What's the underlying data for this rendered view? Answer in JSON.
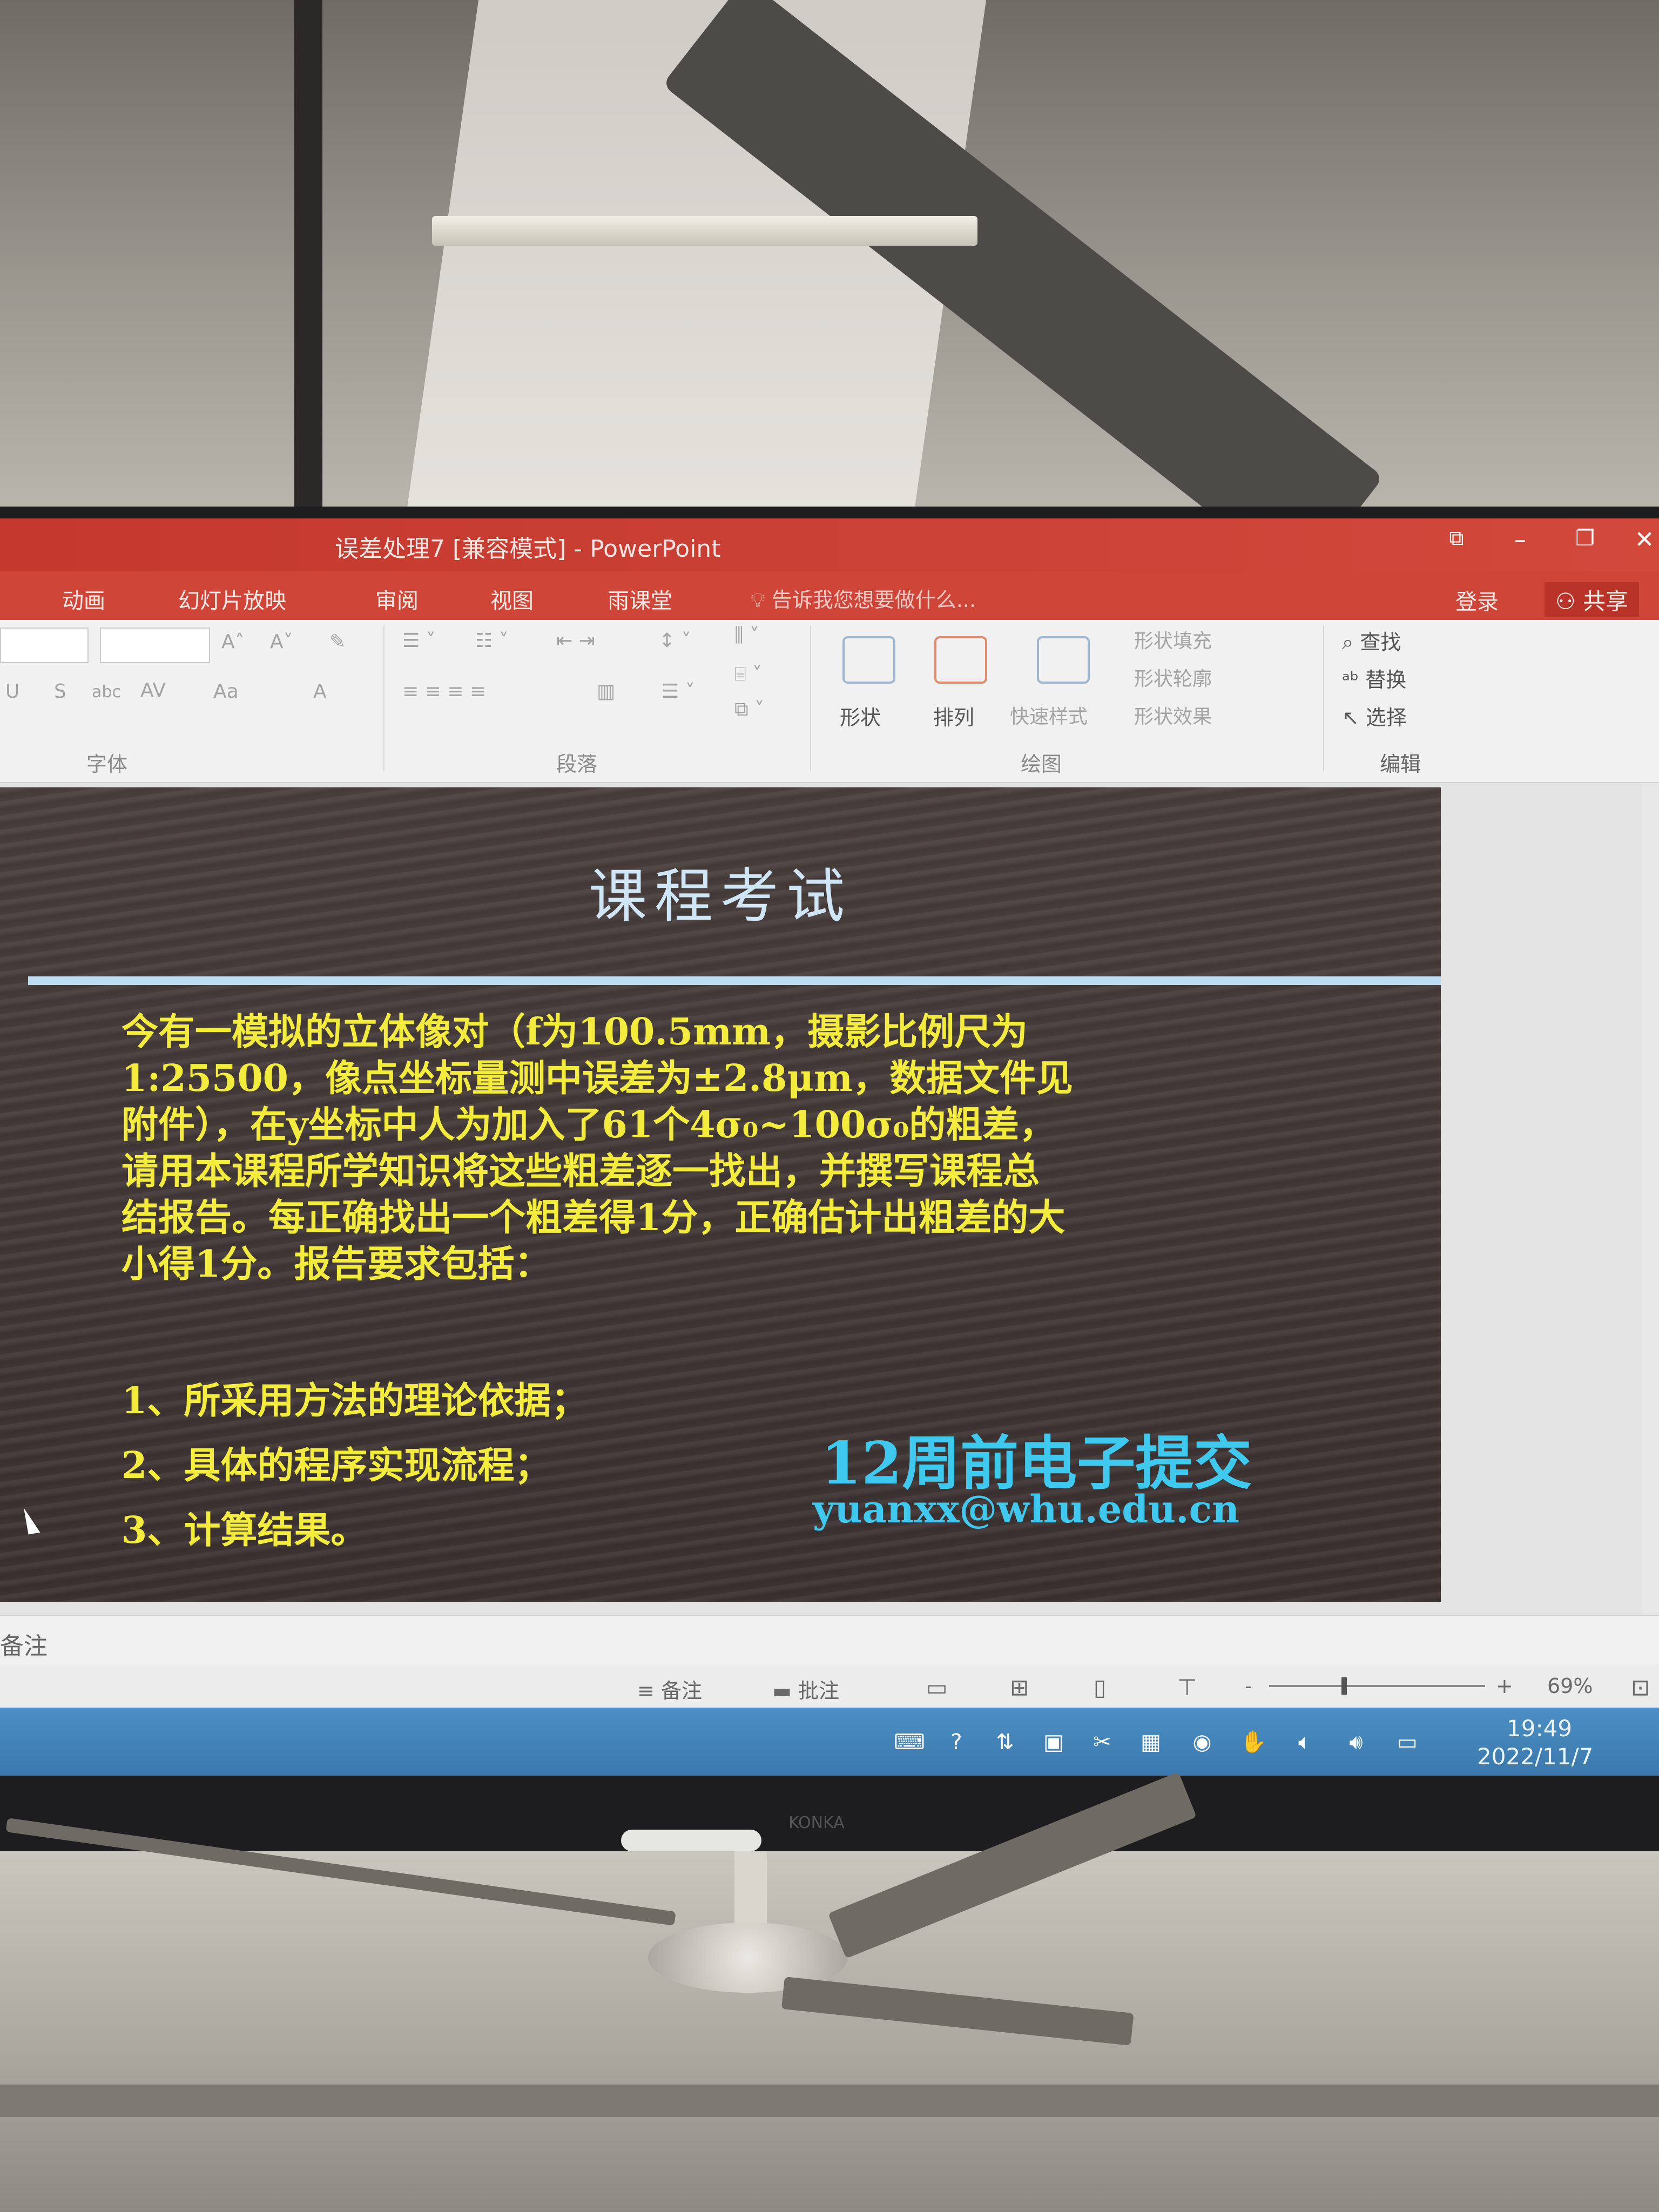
{
  "window": {
    "title": "误差处理7 [兼容模式] - PowerPoint",
    "controls": [
      "⧉",
      "–",
      "❐",
      "✕"
    ]
  },
  "ribbon_tabs": [
    "动画",
    "幻灯片放映",
    "审阅",
    "视图",
    "雨课堂"
  ],
  "tellme": "告诉我您想要做什么...",
  "account": {
    "login": "登录",
    "share": "共享"
  },
  "ribbon": {
    "font_group": "字体",
    "paragraph_group": "段落",
    "drawing_group": "绘图",
    "editing_group": "编辑",
    "shape": "形状",
    "arrange": "排列",
    "quick_styles": "快速样式",
    "shape_fill": "形状填充",
    "shape_outline": "形状轮廓",
    "shape_effects": "形状效果",
    "find": "查找",
    "replace": "替换",
    "select": "选择",
    "font_tools": [
      "A˄",
      "A˅",
      "U",
      "S",
      "abc",
      "AV",
      "Aa",
      "A"
    ]
  },
  "slide": {
    "title": "课程考试",
    "body_lines": [
      "今有一模拟的立体像对（f为100.5mm，摄影比例尺为",
      "1:25500，像点坐标量测中误差为±2.8μm，数据文件见",
      "附件），在y坐标中人为加入了61个4σ₀~100σ₀的粗差，",
      "请用本课程所学知识将这些粗差逐一找出，并撰写课程总",
      "结报告。每正确找出一个粗差得1分，正确估计出粗差的大",
      "小得1分。报告要求包括："
    ],
    "list": [
      "1、所采用方法的理论依据；",
      "2、具体的程序实现流程；",
      "3、计算结果。"
    ],
    "deadline": "12周前电子提交",
    "email": "yuanxx@whu.edu.cn"
  },
  "notes": {
    "placeholder": "备注"
  },
  "statusbar": {
    "notes": "备注",
    "comments": "批注",
    "zoom_minus": "-",
    "zoom_plus": "+",
    "zoom": "69%",
    "zoom_level_percent": 69
  },
  "taskbar": {
    "time": "19:49",
    "date": "2022/11/7"
  },
  "monitor_brand": "KONKA"
}
